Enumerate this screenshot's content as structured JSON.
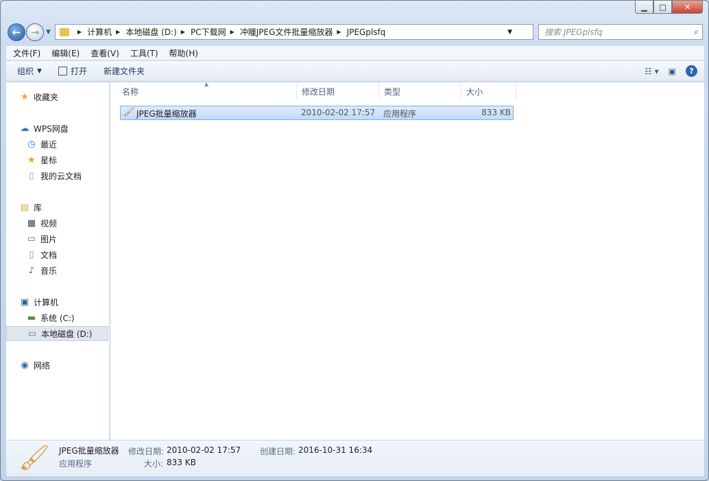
{
  "window": {
    "minimize": "▁",
    "maximize": "□",
    "close": "✕"
  },
  "address": {
    "crumbs": [
      "计算机",
      "本地磁盘 (D:)",
      "PC下载网",
      "冲瞳JPEG文件批量缩放器",
      "JPEGplsfq"
    ]
  },
  "search": {
    "placeholder": "搜索 JPEGplsfq"
  },
  "menu": [
    "文件(F)",
    "编辑(E)",
    "查看(V)",
    "工具(T)",
    "帮助(H)"
  ],
  "toolbar": {
    "organize": "组织",
    "open": "打开",
    "new_folder": "新建文件夹"
  },
  "sidebar": {
    "favorites": "收藏夹",
    "wps": "WPS网盘",
    "recent": "最近",
    "starred": "星标",
    "cloud_docs": "我的云文档",
    "libraries": "库",
    "videos": "视频",
    "pictures": "图片",
    "documents": "文档",
    "music": "音乐",
    "computer": "计算机",
    "drive_c": "系统 (C:)",
    "drive_d": "本地磁盘 (D:)",
    "network": "网络"
  },
  "columns": {
    "name": "名称",
    "modified": "修改日期",
    "type": "类型",
    "size": "大小"
  },
  "files": [
    {
      "name": "JPEG批量缩放器",
      "modified": "2010-02-02 17:57",
      "type": "应用程序",
      "size": "833 KB"
    }
  ],
  "details": {
    "name": "JPEG批量缩放器",
    "type": "应用程序",
    "modified_label": "修改日期:",
    "modified": "2010-02-02 17:57",
    "created_label": "创建日期:",
    "created": "2016-10-31 16:34",
    "size_label": "大小:",
    "size": "833 KB"
  }
}
